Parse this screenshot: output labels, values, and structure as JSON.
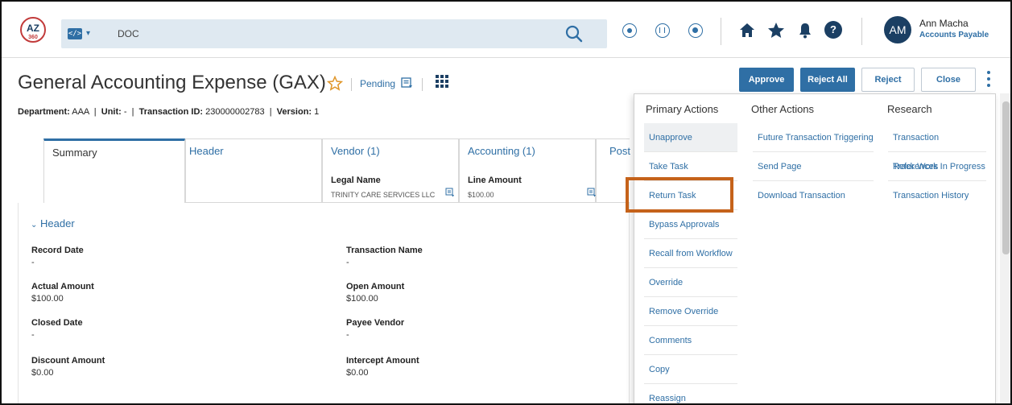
{
  "topbar": {
    "logo_text": "AZ 360",
    "command_type_glyph": "</>",
    "command_text": "DOC",
    "user": {
      "initials": "AM",
      "name": "Ann Macha",
      "role": "Accounts Payable"
    },
    "help_glyph": "?"
  },
  "page": {
    "title": "General Accounting Expense (GAX)",
    "status": "Pending",
    "meta": {
      "department_label": "Department:",
      "department_value": "AAA",
      "unit_label": "Unit:",
      "unit_value": "-",
      "transaction_label": "Transaction ID:",
      "transaction_value": "230000002783",
      "version_label": "Version:",
      "version_value": "1"
    }
  },
  "actions": {
    "approve": "Approve",
    "reject_all": "Reject All",
    "reject": "Reject",
    "close": "Close"
  },
  "tabs": [
    {
      "label": "Summary"
    },
    {
      "label": "Header"
    },
    {
      "label": "Vendor (1)",
      "sub_label": "Legal Name",
      "sub_value": "TRINITY CARE SERVICES LLC"
    },
    {
      "label": "Accounting (1)",
      "sub_label": "Line Amount",
      "sub_value": "$100.00"
    },
    {
      "label": "Post"
    }
  ],
  "header_section": {
    "title": "Header",
    "fields": [
      {
        "label": "Record Date",
        "value": "-"
      },
      {
        "label": "Transaction Name",
        "value": "-"
      },
      {
        "label": "Actual Amount",
        "value": "$100.00"
      },
      {
        "label": "Open Amount",
        "value": "$100.00"
      },
      {
        "label": "Closed Date",
        "value": "-"
      },
      {
        "label": "Payee Vendor",
        "value": "-"
      },
      {
        "label": "Discount Amount",
        "value": "$0.00"
      },
      {
        "label": "Intercept Amount",
        "value": "$0.00"
      }
    ]
  },
  "menu": {
    "primary": {
      "title": "Primary Actions",
      "items": [
        "Unapprove",
        "Take Task",
        "Return Task",
        "Bypass Approvals",
        "Recall from Workflow",
        "Override",
        "Remove Override",
        "Comments",
        "Copy",
        "Reassign"
      ]
    },
    "other": {
      "title": "Other Actions",
      "items": [
        "Future Transaction Triggering",
        "Send Page",
        "Download Transaction"
      ]
    },
    "research": {
      "title": "Research",
      "items": [
        "Transaction References",
        "Track Work In Progress",
        "Transaction History"
      ]
    }
  },
  "colors": {
    "accent": "#2f6fa5",
    "dark": "#1b3f63",
    "highlight": "#c5621a",
    "command_bar": "#dfe9f1"
  }
}
